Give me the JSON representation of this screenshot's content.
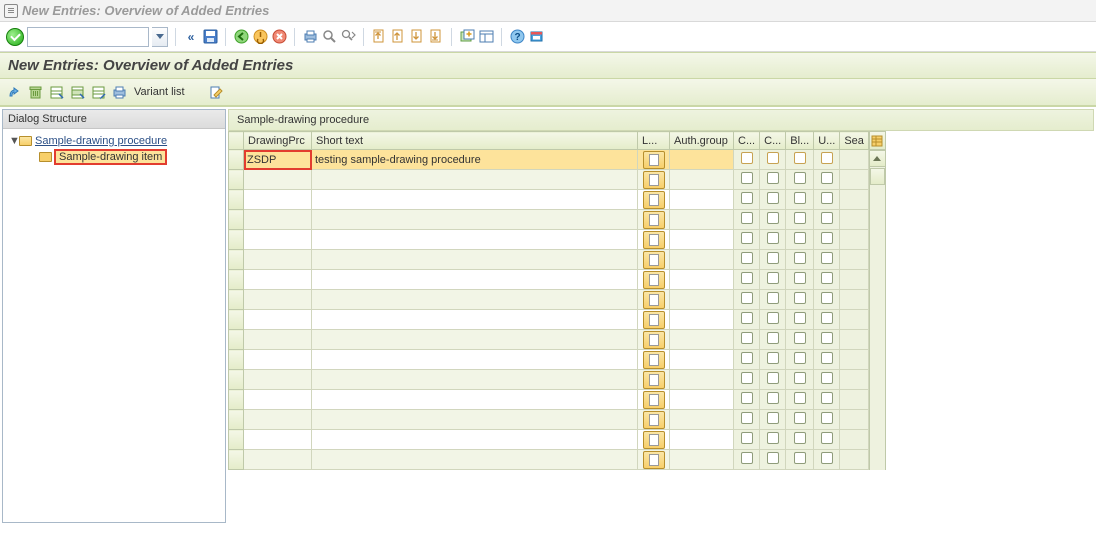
{
  "window": {
    "title": "New Entries: Overview of Added Entries"
  },
  "subheader": {
    "title": "New Entries: Overview of Added Entries"
  },
  "cmdbar": {
    "value": ""
  },
  "app_toolbar": {
    "variant_label": "Variant list"
  },
  "left_panel": {
    "title": "Dialog Structure",
    "root_label": "Sample-drawing procedure",
    "child_label": "Sample-drawing item"
  },
  "table": {
    "title": "Sample-drawing procedure",
    "columns": {
      "drawingprc": "DrawingPrc",
      "short_text": "Short text",
      "l": "L...",
      "auth_group": "Auth.group",
      "c1": "C...",
      "c2": "C...",
      "bl": "Bl...",
      "u": "U...",
      "sea": "Sea"
    },
    "rows": [
      {
        "drawingprc": "ZSDP",
        "short_text": "testing sample-drawing procedure",
        "highlighted": true
      },
      {
        "drawingprc": "",
        "short_text": ""
      },
      {
        "drawingprc": "",
        "short_text": ""
      },
      {
        "drawingprc": "",
        "short_text": ""
      },
      {
        "drawingprc": "",
        "short_text": ""
      },
      {
        "drawingprc": "",
        "short_text": ""
      },
      {
        "drawingprc": "",
        "short_text": ""
      },
      {
        "drawingprc": "",
        "short_text": ""
      },
      {
        "drawingprc": "",
        "short_text": ""
      },
      {
        "drawingprc": "",
        "short_text": ""
      },
      {
        "drawingprc": "",
        "short_text": ""
      },
      {
        "drawingprc": "",
        "short_text": ""
      },
      {
        "drawingprc": "",
        "short_text": ""
      },
      {
        "drawingprc": "",
        "short_text": ""
      },
      {
        "drawingprc": "",
        "short_text": ""
      },
      {
        "drawingprc": "",
        "short_text": ""
      }
    ]
  },
  "icons": {
    "save": "save-icon",
    "back": "back-icon",
    "exit": "exit-icon",
    "cancel": "cancel-icon",
    "print": "print-icon",
    "find": "find-icon",
    "find_next": "find-next-icon",
    "first": "first-page-icon",
    "prev": "prev-page-icon",
    "next": "next-page-icon",
    "last": "last-page-icon",
    "new_session": "new-session-icon",
    "layout": "layout-icon",
    "help": "help-icon",
    "customize": "customize-icon",
    "expand": "expand-icon",
    "delete": "delete-icon",
    "select_all": "select-all-icon",
    "select_block": "select-block-icon",
    "deselect": "deselect-icon",
    "print2": "print2-icon",
    "edit": "edit-icon"
  }
}
